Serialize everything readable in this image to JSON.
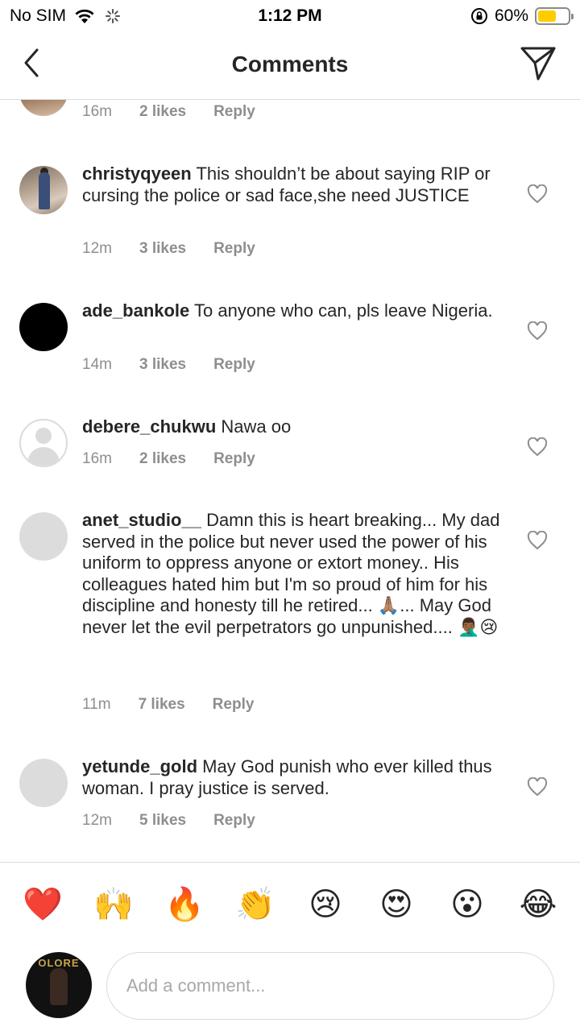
{
  "status_bar": {
    "carrier": "No SIM",
    "time": "1:12 PM",
    "battery": "60%",
    "battery_level": 0.6,
    "battery_color": "#ffcc00"
  },
  "header": {
    "title": "Comments"
  },
  "comments": [
    {
      "username": "",
      "text": "",
      "time": "16m",
      "likes": "2 likes",
      "reply": "Reply"
    },
    {
      "username": "christyqyeen",
      "text": "This shouldn’t be about saying RIP or cursing the police or sad face,she need JUSTICE",
      "time": "12m",
      "likes": "3 likes",
      "reply": "Reply"
    },
    {
      "username": "ade_bankole",
      "text": "To anyone who can, pls leave Nigeria.",
      "time": "14m",
      "likes": "3 likes",
      "reply": "Reply"
    },
    {
      "username": "debere_chukwu",
      "text": "Nawa oo",
      "time": "16m",
      "likes": "2 likes",
      "reply": "Reply"
    },
    {
      "username": "anet_studio__",
      "text": "Damn this is heart breaking... My dad served in the police but never used the power of his uniform to oppress anyone or extort money.. His colleagues hated him but I'm so proud of him for his discipline and honesty till he retired... 🙏🏽... May God never let the evil perpetrators go unpunished.... 🤦🏾‍♂️😢",
      "time": "11m",
      "likes": "7 likes",
      "reply": "Reply"
    },
    {
      "username": "yetunde_gold",
      "text": "May God punish who ever killed thus woman. I pray justice is served.",
      "time": "12m",
      "likes": "5 likes",
      "reply": "Reply"
    }
  ],
  "reactions": [
    "❤️",
    "🙌",
    "🔥",
    "👏",
    "😢",
    "😍",
    "😮",
    "😂"
  ],
  "composer": {
    "placeholder": "Add a comment...",
    "avatar_text": "OLORE"
  }
}
